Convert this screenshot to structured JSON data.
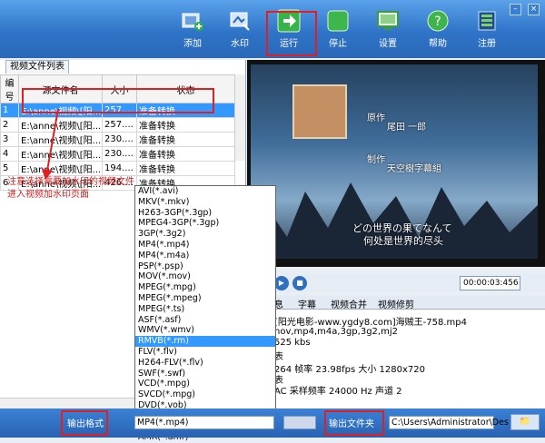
{
  "toolbar": {
    "buttons": [
      {
        "label": "添加",
        "icon": "add-video-icon"
      },
      {
        "label": "水印",
        "icon": "watermark-icon"
      },
      {
        "label": "运行",
        "icon": "run-arrow-icon"
      },
      {
        "label": "停止",
        "icon": "stop-icon"
      },
      {
        "label": "设置",
        "icon": "settings-monitor-icon"
      },
      {
        "label": "帮助",
        "icon": "help-icon"
      },
      {
        "label": "注册",
        "icon": "register-icon"
      }
    ],
    "window_controls": [
      "–",
      "×"
    ]
  },
  "file_list": {
    "tab": "视频文件列表",
    "columns": [
      "编号",
      "源文件名",
      "大小",
      "状态"
    ],
    "rows": [
      {
        "no": "1",
        "name": "E:\\anne\\视频\\[阳...",
        "size": "257....",
        "status": "准备转换"
      },
      {
        "no": "2",
        "name": "E:\\anne\\视频\\[阳...",
        "size": "257....",
        "status": "准备转换"
      },
      {
        "no": "3",
        "name": "E:\\anne\\视频\\[阳...",
        "size": "230....",
        "status": "准备转换"
      },
      {
        "no": "4",
        "name": "E:\\anne\\视频\\[阳...",
        "size": "230....",
        "status": "准备转换"
      },
      {
        "no": "5",
        "name": "E:\\anne\\视频\\[阳...",
        "size": "194....",
        "status": "准备转换"
      },
      {
        "no": "6",
        "name": "E:\\anne\\视频\\[阳...",
        "size": "426....",
        "status": "准备转换"
      }
    ]
  },
  "annotation": {
    "line1": "注意选择需要加水印的视频文件",
    "line2": "进入视频加水印页面"
  },
  "preview": {
    "credits": [
      "原作",
      "尾田 一郎",
      "制作",
      "天空樹字幕組"
    ],
    "subtitle_jp": "どの世界の果てなんて",
    "subtitle_cn": "何处是世界的尽头"
  },
  "player": {
    "time": "00:00:03:456",
    "play": "▶",
    "stop": "■"
  },
  "info": {
    "tabs": [
      "息",
      "字幕",
      "视频合并",
      "视频修剪"
    ],
    "lines": [
      "[阳光电影-www.ygdy8.com]海贼王-758.mp4",
      "nov,mp4,m4a,3gp,3g2,mj2",
      "525 kbs",
      "表",
      "264  帧率  23.98fps  大小  1280x720",
      "表",
      "AC  采样频率  24000 Hz   声道  2"
    ]
  },
  "format_dropdown": {
    "options": [
      "AVI(*.avi)",
      "MKV(*.mkv)",
      "H263-3GP(*.3gp)",
      "MPEG4-3GP(*.3gp)",
      "3GP(*.3g2)",
      "MP4(*.mp4)",
      "MP4(*.m4a)",
      "PSP(*.psp)",
      "MOV(*.mov)",
      "MPEG(*.mpg)",
      "MPEG(*.mpeg)",
      "MPEG(*.ts)",
      "ASF(*.asf)",
      "WMV(*.wmv)",
      "RMVB(*.rm)",
      "FLV(*.flv)",
      "H264-FLV(*.flv)",
      "SWF(*.swf)",
      "VCD(*.mpg)",
      "SVCD(*.mpg)",
      "DVD(*.vob)",
      "MP3(*.mp3)",
      "WAV(*.wav)",
      "AMR(*.amr)"
    ],
    "selected": "RMVB(*.rm)"
  },
  "bottom": {
    "format_label": "输出格式",
    "format_value": "MP4(*.mp4)",
    "folder_label": "输出文件夹",
    "folder_path": "C:\\Users\\Administrator\\Des",
    "browse": "📁"
  },
  "colors": {
    "accent": "#2f74c8",
    "highlight": "#e02020",
    "selection": "#3399ff"
  }
}
